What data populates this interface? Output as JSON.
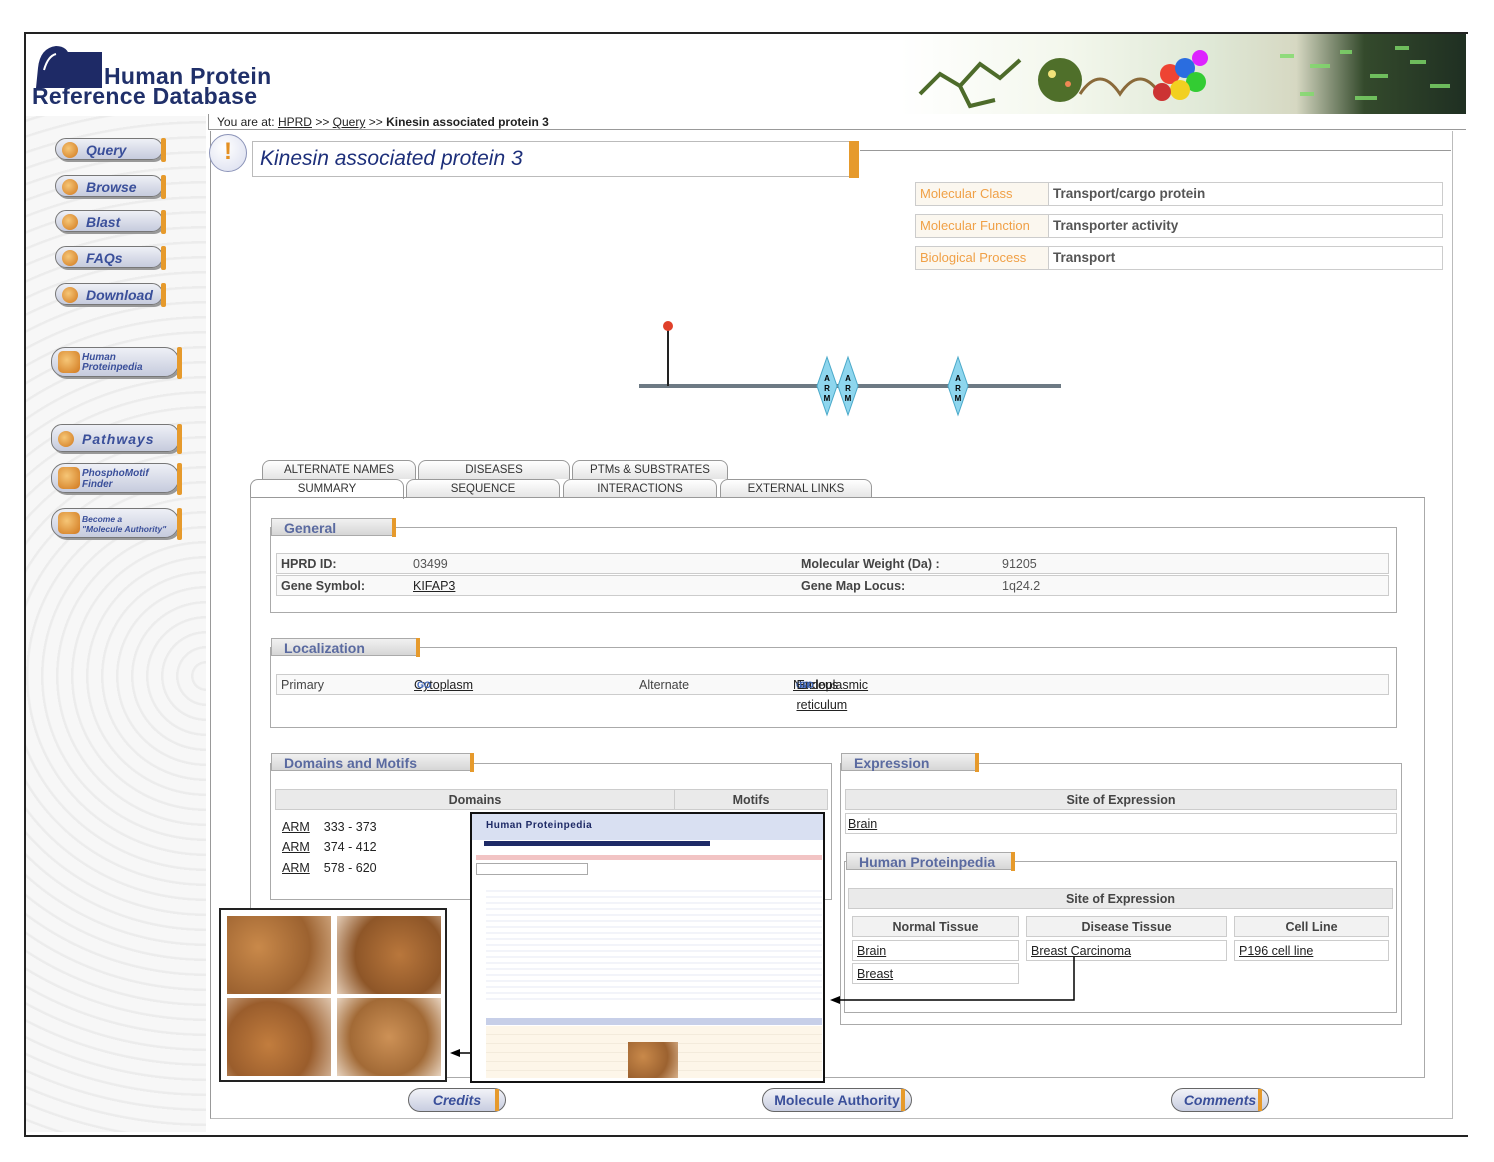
{
  "logo": {
    "line1": "Human Protein",
    "line2": "Reference Database"
  },
  "breadcrumb": {
    "prefix": "You are at:",
    "hprd": "HPRD",
    "sep1": ">>",
    "query": "Query",
    "sep2": ">>",
    "current": "Kinesin associated protein 3"
  },
  "nav": {
    "query": "Query",
    "browse": "Browse",
    "blast": "Blast",
    "faqs": "FAQs",
    "download": "Download",
    "proteinpedia_1": "Human",
    "proteinpedia_2": "Proteinpedia",
    "pathways": "Pathways",
    "phospho_1": "PhosphoMotif",
    "phospho_2": "Finder",
    "authority_1": "Become a",
    "authority_2": "\"Molecule Authority\""
  },
  "protein": {
    "title": "Kinesin associated protein 3",
    "warning_icon": "!"
  },
  "classification": [
    {
      "key": "Molecular Class",
      "value": "Transport/cargo protein"
    },
    {
      "key": "Molecular Function",
      "value": "Transporter activity"
    },
    {
      "key": "Biological Process",
      "value": "Transport"
    }
  ],
  "domain_map": {
    "domains": [
      "ARM",
      "ARM",
      "ARM"
    ],
    "domain_letters": [
      "A",
      "R",
      "M"
    ]
  },
  "tabs": {
    "row1": [
      "ALTERNATE NAMES",
      "DISEASES",
      "PTMs & SUBSTRATES"
    ],
    "row2": [
      "SUMMARY",
      "SEQUENCE",
      "INTERACTIONS",
      "EXTERNAL LINKS"
    ]
  },
  "general": {
    "title": "General",
    "hprd_id_label": "HPRD ID:",
    "hprd_id": "03499",
    "mw_label": "Molecular Weight (Da) :",
    "mw": "91205",
    "gene_label": "Gene Symbol:",
    "gene": "KIFAP3",
    "locus_label": "Gene Map Locus:",
    "locus": "1q24.2"
  },
  "localization": {
    "title": "Localization",
    "primary_label": "Primary",
    "primary": "Cytoplasm",
    "alternate_label": "Alternate",
    "alt1": "Nucleus",
    "alt2": "Endoplasmic reticulum",
    "go": "GO"
  },
  "domains": {
    "title": "Domains and Motifs",
    "col_domains": "Domains",
    "col_motifs": "Motifs",
    "rows": [
      {
        "name": "ARM",
        "range": "333 - 373"
      },
      {
        "name": "ARM",
        "range": "374 - 412"
      },
      {
        "name": "ARM",
        "range": "578 - 620"
      }
    ]
  },
  "expression": {
    "title": "Expression",
    "site_header": "Site of Expression",
    "site": "Brain",
    "hp_title": "Human Proteinpedia",
    "hp_site_header": "Site of Expression",
    "normal_header": "Normal Tissue",
    "disease_header": "Disease Tissue",
    "cell_header": "Cell Line",
    "normal": [
      "Brain",
      "Breast"
    ],
    "disease": [
      "Breast Carcinoma"
    ],
    "cell": [
      "P196 cell line"
    ]
  },
  "inset": {
    "title": "Human Proteinpedia"
  },
  "footer": {
    "credits": "Credits",
    "authority": "Molecule Authority",
    "comments": "Comments"
  },
  "colors": {
    "accent": "#e69a2c",
    "link_blue": "#3a4f9a",
    "class_key": "#f0a046"
  }
}
